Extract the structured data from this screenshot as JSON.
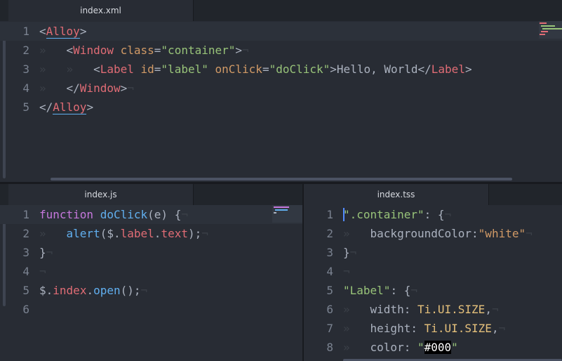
{
  "top_pane": {
    "tab_label": "index.xml",
    "lines": [
      {
        "num": "1",
        "tokens": [
          [
            "t-punc",
            "<"
          ],
          [
            "t-tag u",
            "Alloy"
          ],
          [
            "t-punc",
            ">"
          ]
        ]
      },
      {
        "num": "2",
        "tokens": [
          [
            "t-invis",
            "»   "
          ],
          [
            "t-punc",
            "<"
          ],
          [
            "t-tag",
            "Window"
          ],
          [
            "t-plain",
            " "
          ],
          [
            "t-attr",
            "class"
          ],
          [
            "t-punc",
            "="
          ],
          [
            "t-str",
            "\"container\""
          ],
          [
            "t-punc",
            ">"
          ],
          [
            "t-invis",
            "¬"
          ]
        ]
      },
      {
        "num": "3",
        "tokens": [
          [
            "t-invis",
            "»   »   "
          ],
          [
            "t-punc",
            "<"
          ],
          [
            "t-tag",
            "Label"
          ],
          [
            "t-plain",
            " "
          ],
          [
            "t-attr",
            "id"
          ],
          [
            "t-punc",
            "="
          ],
          [
            "t-str",
            "\"label\""
          ],
          [
            "t-plain",
            " "
          ],
          [
            "t-attr",
            "onClick"
          ],
          [
            "t-punc",
            "="
          ],
          [
            "t-str",
            "\"doClick\""
          ],
          [
            "t-punc",
            ">"
          ],
          [
            "t-plain",
            "Hello, World"
          ],
          [
            "t-punc",
            "</"
          ],
          [
            "t-tag",
            "Label"
          ],
          [
            "t-punc",
            ">"
          ]
        ]
      },
      {
        "num": "4",
        "tokens": [
          [
            "t-invis",
            "»   "
          ],
          [
            "t-punc",
            "</"
          ],
          [
            "t-tag",
            "Window"
          ],
          [
            "t-punc",
            ">"
          ],
          [
            "t-invis",
            "¬"
          ]
        ]
      },
      {
        "num": "5",
        "tokens": [
          [
            "t-punc",
            "</"
          ],
          [
            "t-tag u",
            "Alloy"
          ],
          [
            "t-punc",
            ">"
          ]
        ]
      }
    ]
  },
  "js_pane": {
    "tab_label": "index.js",
    "lines": [
      {
        "num": "1",
        "tokens": [
          [
            "t-kw",
            "function"
          ],
          [
            "t-plain",
            " "
          ],
          [
            "t-fn",
            "doClick"
          ],
          [
            "t-punc",
            "("
          ],
          [
            "t-plain",
            "e"
          ],
          [
            "t-punc",
            ")"
          ],
          [
            "t-plain",
            " "
          ],
          [
            "t-punc",
            "{"
          ],
          [
            "t-invis",
            "¬"
          ]
        ]
      },
      {
        "num": "2",
        "tokens": [
          [
            "t-invis",
            "»   "
          ],
          [
            "t-fn",
            "alert"
          ],
          [
            "t-punc",
            "("
          ],
          [
            "t-plain",
            "$"
          ],
          [
            "t-punc",
            "."
          ],
          [
            "t-prop",
            "label"
          ],
          [
            "t-punc",
            "."
          ],
          [
            "t-prop",
            "text"
          ],
          [
            "t-punc",
            ");"
          ],
          [
            "t-invis",
            "¬"
          ]
        ]
      },
      {
        "num": "3",
        "tokens": [
          [
            "t-punc",
            "}"
          ],
          [
            "t-invis",
            "¬"
          ]
        ]
      },
      {
        "num": "4",
        "tokens": [
          [
            "t-invis",
            "¬"
          ]
        ]
      },
      {
        "num": "5",
        "tokens": [
          [
            "t-plain",
            "$"
          ],
          [
            "t-punc",
            "."
          ],
          [
            "t-prop",
            "index"
          ],
          [
            "t-punc",
            "."
          ],
          [
            "t-fn",
            "open"
          ],
          [
            "t-punc",
            "();"
          ],
          [
            "t-invis",
            "¬"
          ]
        ]
      },
      {
        "num": "6",
        "tokens": []
      }
    ]
  },
  "tss_pane": {
    "tab_label": "index.tss",
    "lines": [
      {
        "num": "1",
        "tokens": [
          [
            "t-str",
            "\".container\""
          ],
          [
            "t-punc",
            ":"
          ],
          [
            "t-plain",
            " "
          ],
          [
            "t-punc",
            "{"
          ],
          [
            "t-invis",
            "¬"
          ]
        ]
      },
      {
        "num": "2",
        "tokens": [
          [
            "t-invis",
            "»   "
          ],
          [
            "t-plain",
            "backgroundColor"
          ],
          [
            "t-punc",
            ":"
          ],
          [
            "t-num",
            "\"white\""
          ],
          [
            "t-invis",
            "¬"
          ]
        ]
      },
      {
        "num": "3",
        "tokens": [
          [
            "t-punc",
            "}"
          ],
          [
            "t-invis",
            "¬"
          ]
        ]
      },
      {
        "num": "4",
        "tokens": [
          [
            "t-invis",
            "¬"
          ]
        ]
      },
      {
        "num": "5",
        "tokens": [
          [
            "t-str",
            "\"Label\""
          ],
          [
            "t-punc",
            ":"
          ],
          [
            "t-plain",
            " "
          ],
          [
            "t-punc",
            "{"
          ],
          [
            "t-invis",
            "¬"
          ]
        ]
      },
      {
        "num": "6",
        "tokens": [
          [
            "t-invis",
            "»   "
          ],
          [
            "t-plain",
            "width"
          ],
          [
            "t-punc",
            ":"
          ],
          [
            "t-plain",
            " "
          ],
          [
            "t-key",
            "Ti.UI.SIZE"
          ],
          [
            "t-punc",
            ","
          ],
          [
            "t-invis",
            "¬"
          ]
        ]
      },
      {
        "num": "7",
        "tokens": [
          [
            "t-invis",
            "»   "
          ],
          [
            "t-plain",
            "height"
          ],
          [
            "t-punc",
            ":"
          ],
          [
            "t-plain",
            " "
          ],
          [
            "t-key",
            "Ti.UI.SIZE"
          ],
          [
            "t-punc",
            ","
          ],
          [
            "t-invis",
            "¬"
          ]
        ]
      },
      {
        "num": "8",
        "tokens": [
          [
            "t-invis",
            "»   "
          ],
          [
            "t-plain",
            "color"
          ],
          [
            "t-punc",
            ":"
          ],
          [
            "t-plain",
            " "
          ],
          [
            "t-str",
            "\""
          ],
          [
            "hl",
            "#000"
          ],
          [
            "t-str",
            "\""
          ]
        ]
      }
    ]
  },
  "colors": {
    "background": "#282c34",
    "tabbar": "#21252b",
    "tag": "#e06c75",
    "attribute": "#d19a66",
    "string": "#98c379",
    "keyword": "#c678dd",
    "function": "#61afef"
  }
}
